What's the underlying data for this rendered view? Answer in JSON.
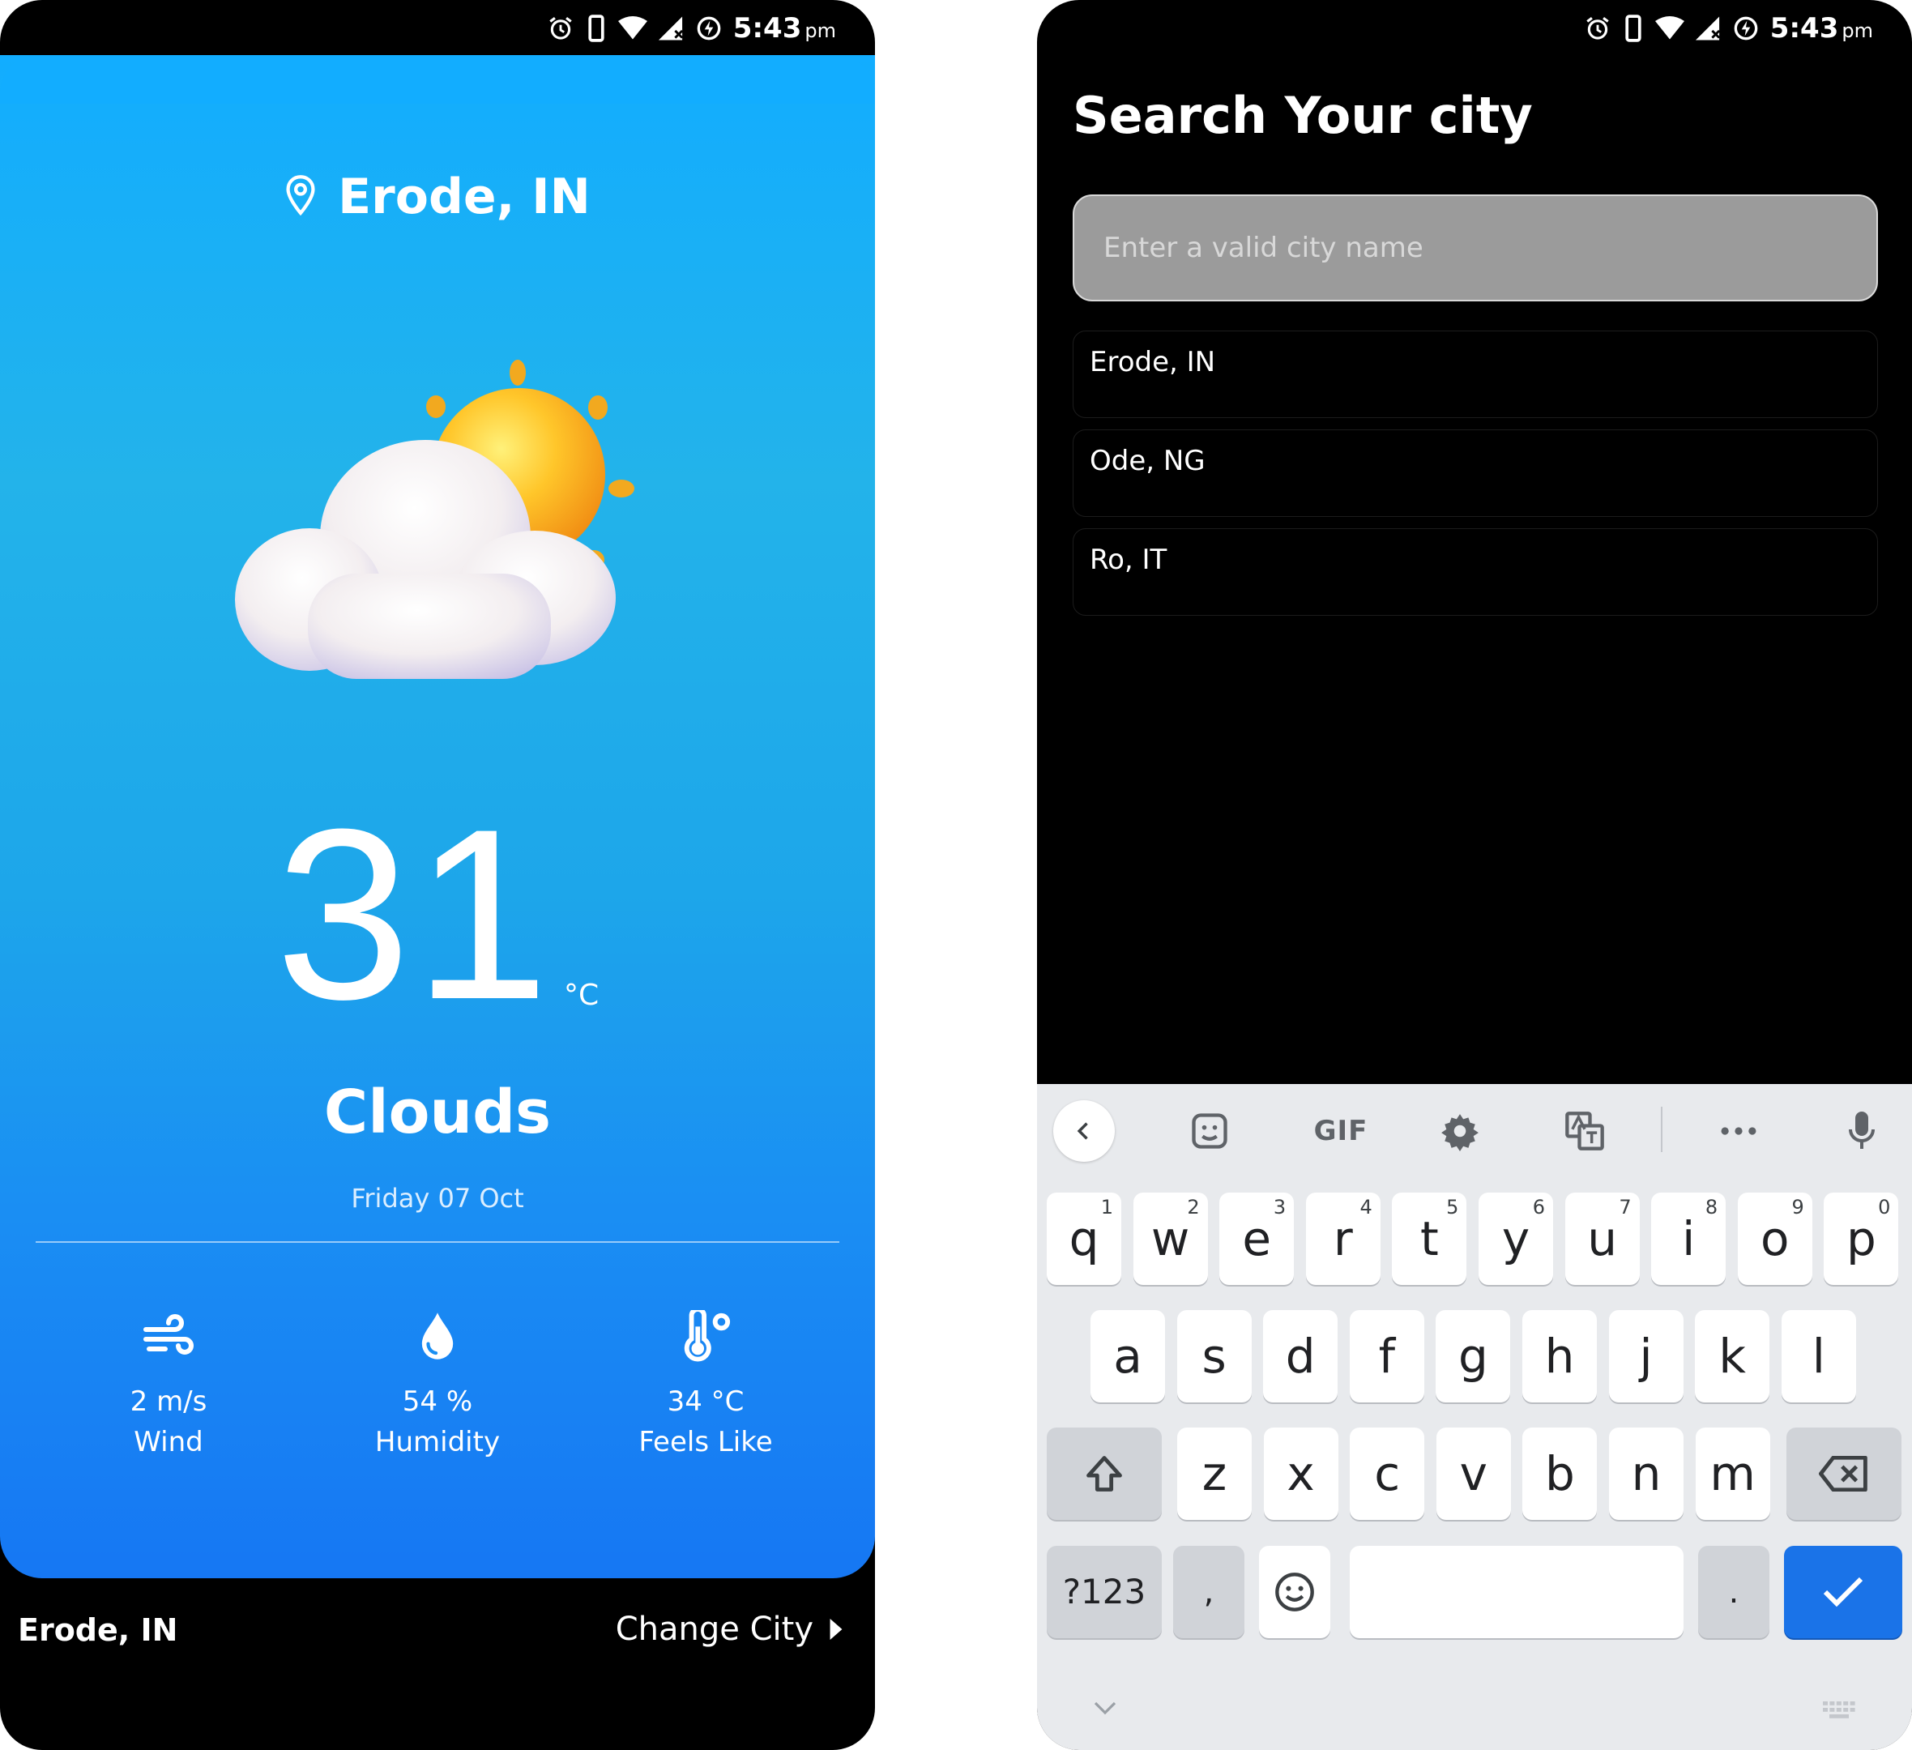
{
  "status_bar": {
    "time": "5:43",
    "ampm": "pm"
  },
  "weather": {
    "location": "Erode, IN",
    "temperature": "31",
    "unit": "°C",
    "condition": "Clouds",
    "date": "Friday 07 Oct",
    "stats": {
      "wind": {
        "value": "2 m/s",
        "label": "Wind",
        "icon": "wind-icon"
      },
      "humidity": {
        "value": "54 %",
        "label": "Humidity",
        "icon": "water-drop-icon"
      },
      "feels_like": {
        "value": "34 °C",
        "label": "Feels Like",
        "icon": "thermometer-icon"
      }
    },
    "illustration": "partly-cloudy-icon"
  },
  "bottom_bar": {
    "city": "Erode, IN",
    "change_city": "Change City"
  },
  "search": {
    "title": "Search Your city",
    "placeholder": "Enter a valid city name",
    "results": [
      "Erode, IN",
      "Ode, NG",
      "Ro, IT"
    ]
  },
  "keyboard": {
    "toolbar": {
      "gif": "GIF"
    },
    "row1": [
      {
        "k": "q",
        "h": "1"
      },
      {
        "k": "w",
        "h": "2"
      },
      {
        "k": "e",
        "h": "3"
      },
      {
        "k": "r",
        "h": "4"
      },
      {
        "k": "t",
        "h": "5"
      },
      {
        "k": "y",
        "h": "6"
      },
      {
        "k": "u",
        "h": "7"
      },
      {
        "k": "i",
        "h": "8"
      },
      {
        "k": "o",
        "h": "9"
      },
      {
        "k": "p",
        "h": "0"
      }
    ],
    "row2": [
      "a",
      "s",
      "d",
      "f",
      "g",
      "h",
      "j",
      "k",
      "l"
    ],
    "row3": [
      "z",
      "x",
      "c",
      "v",
      "b",
      "n",
      "m"
    ],
    "symbols": "?123",
    "comma": ",",
    "period": "."
  },
  "colors": {
    "card_top": "#12adff",
    "card_bottom": "#1677f3",
    "keyboard_bg": "#e8eaed",
    "enter_key": "#1a73e8"
  }
}
